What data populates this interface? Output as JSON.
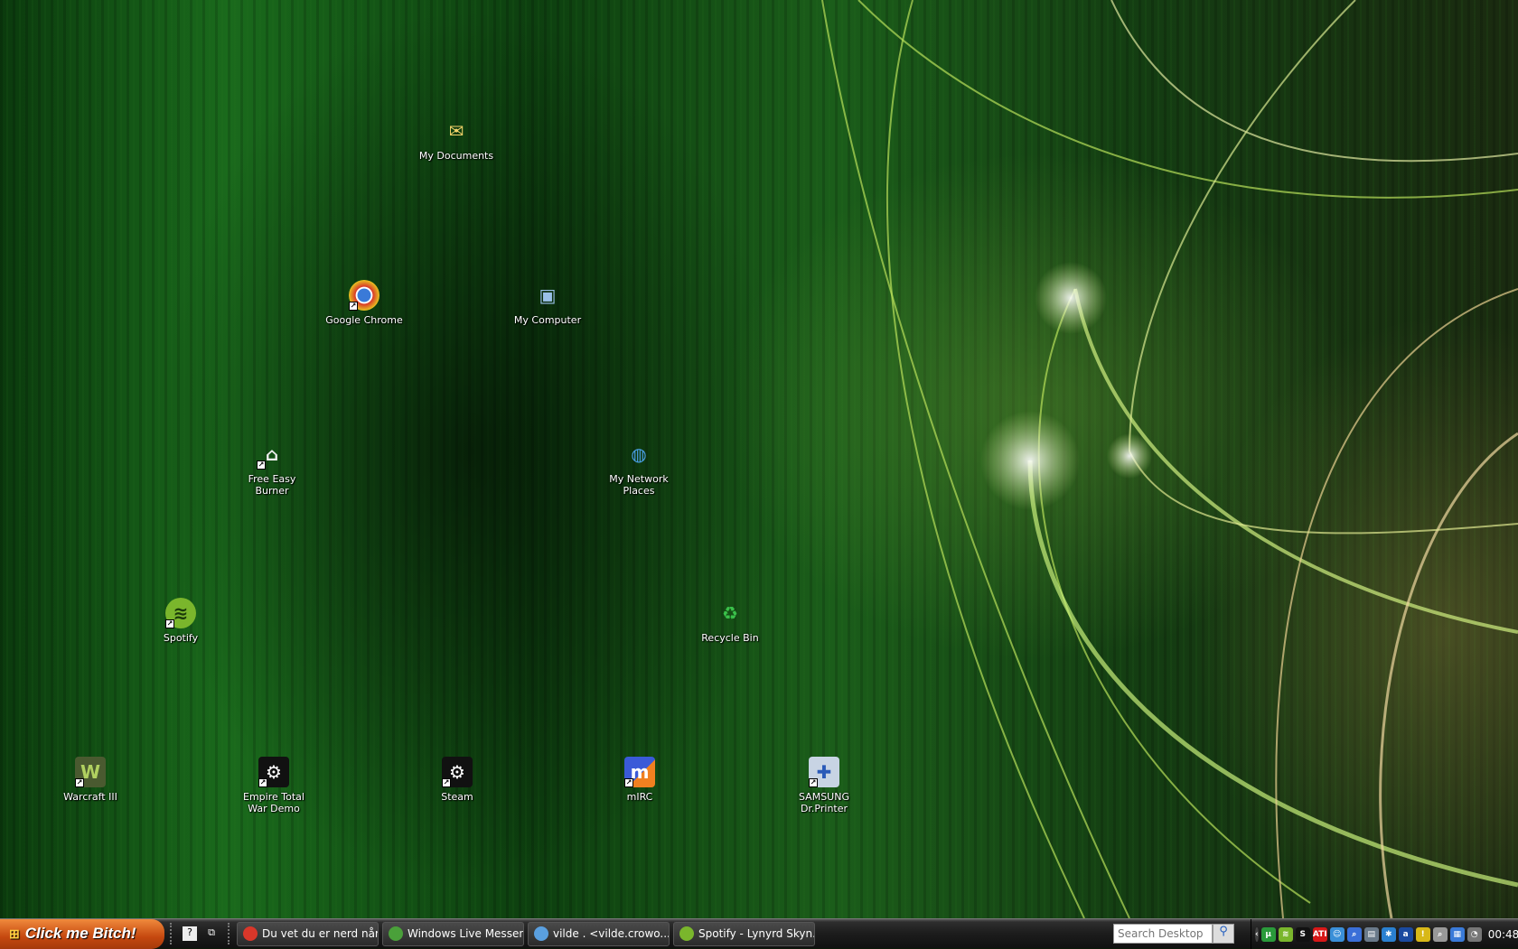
{
  "desktop": {
    "icons": [
      {
        "id": "my-documents",
        "label": "My Documents",
        "glyph": "✉",
        "color": "#f3d36a",
        "shortcut": false
      },
      {
        "id": "google-chrome",
        "label": "Google Chrome",
        "glyph": "◉",
        "color": "#d9372a",
        "shortcut": true
      },
      {
        "id": "my-computer",
        "label": "My Computer",
        "glyph": "▣",
        "color": "#6a9fd8",
        "shortcut": false
      },
      {
        "id": "free-easy-burner",
        "label": "Free Easy Burner",
        "glyph": "⌂",
        "color": "#e0e0e0",
        "shortcut": true
      },
      {
        "id": "my-network-places",
        "label": "My Network Places",
        "glyph": "◍",
        "color": "#3a8fd8",
        "shortcut": false
      },
      {
        "id": "spotify",
        "label": "Spotify",
        "glyph": "≋",
        "color": "#7ab62c",
        "shortcut": true
      },
      {
        "id": "recycle-bin",
        "label": "Recycle Bin",
        "glyph": "♻",
        "color": "#bfe0f0",
        "shortcut": false
      },
      {
        "id": "warcraft-iii",
        "label": "Warcraft III",
        "glyph": "W",
        "color": "#4a5a30",
        "shortcut": true
      },
      {
        "id": "empire-total-war-demo",
        "label": "Empire Total War Demo",
        "glyph": "⚙",
        "color": "#111111",
        "shortcut": true
      },
      {
        "id": "steam",
        "label": "Steam",
        "glyph": "⚙",
        "color": "#111111",
        "shortcut": true
      },
      {
        "id": "mirc",
        "label": "mIRC",
        "glyph": "m",
        "color": "#3a5ad8",
        "shortcut": true
      },
      {
        "id": "samsung-dr-printer",
        "label": "SAMSUNG Dr.Printer",
        "glyph": "✚",
        "color": "#8aa0c0",
        "shortcut": true
      }
    ]
  },
  "taskbar": {
    "start_label": "Click me Bitch!",
    "tasks": [
      {
        "label": "Du vet du er nerd når...",
        "color": "#d9372a"
      },
      {
        "label": "Windows Live Messen...",
        "color": "#4aa03a"
      },
      {
        "label": "vilde . <vilde.crowo...",
        "color": "#5aa0e0"
      },
      {
        "label": "Spotify - Lynyrd Skyn...",
        "color": "#7ab62c"
      }
    ],
    "search_placeholder": "Search Desktop",
    "tray_icons": [
      {
        "name": "utorrent",
        "glyph": "µ",
        "color": "#2a9a3a"
      },
      {
        "name": "spotify",
        "glyph": "≋",
        "color": "#7ab62c"
      },
      {
        "name": "steam",
        "glyph": "S",
        "color": "#111"
      },
      {
        "name": "ati",
        "glyph": "ATI",
        "color": "#d81818"
      },
      {
        "name": "messenger",
        "glyph": "☺",
        "color": "#3a8fd8"
      },
      {
        "name": "search",
        "glyph": "⌕",
        "color": "#3a6fd8"
      },
      {
        "name": "device",
        "glyph": "▤",
        "color": "#6a7a8a"
      },
      {
        "name": "network-x",
        "glyph": "✱",
        "color": "#2a80d0"
      },
      {
        "name": "avast",
        "glyph": "a",
        "color": "#1a4aa0"
      },
      {
        "name": "security-shield",
        "glyph": "!",
        "color": "#d8b818"
      },
      {
        "name": "magnifier",
        "glyph": "⌕",
        "color": "#999"
      },
      {
        "name": "network-connections",
        "glyph": "▦",
        "color": "#3a7ad8"
      },
      {
        "name": "volume",
        "glyph": "◔",
        "color": "#777"
      }
    ],
    "clock": "00:48"
  }
}
